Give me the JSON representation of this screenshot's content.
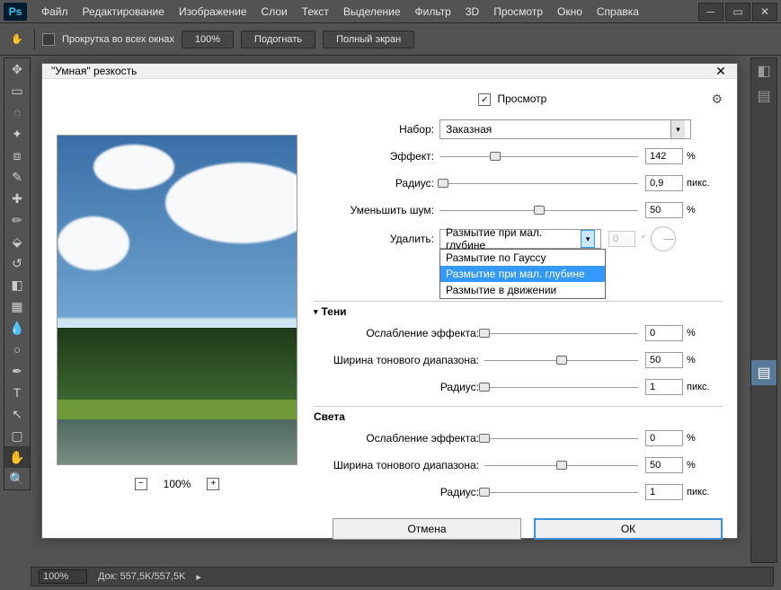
{
  "app": {
    "logo": "Ps"
  },
  "menu": {
    "file": "Файл",
    "edit": "Редактирование",
    "image": "Изображение",
    "layer": "Слои",
    "type": "Текст",
    "select": "Выделение",
    "filter": "Фильтр",
    "threeD": "3D",
    "view": "Просмотр",
    "window": "Окно",
    "help": "Справка"
  },
  "optbar": {
    "scroll_all": "Прокрутка во всех окнах",
    "zoom100": "100%",
    "fit": "Подогнать",
    "fullscreen": "Полный экран"
  },
  "dialog": {
    "title": "\"Умная\" резкость",
    "preview_chk": "Просмотр",
    "preset_label": "Набор:",
    "preset_value": "Заказная",
    "amount_label": "Эффект:",
    "amount_value": "142",
    "amount_unit": "%",
    "radius_label": "Радиус:",
    "radius_value": "0,9",
    "radius_unit": "пикс.",
    "noise_label": "Уменьшить шум:",
    "noise_value": "50",
    "noise_unit": "%",
    "remove_label": "Удалить:",
    "remove_value": "Размытие при мал. глубине",
    "remove_options": {
      "gauss": "Размытие по Гауссу",
      "lens": "Размытие при мал. глубине",
      "motion": "Размытие в движении"
    },
    "angle_value": "0",
    "shadows": {
      "title": "Тени",
      "fade_label": "Ослабление эффекта:",
      "fade_value": "0",
      "fade_unit": "%",
      "tonal_label": "Ширина тонового диапазона:",
      "tonal_value": "50",
      "tonal_unit": "%",
      "radius_label": "Радиус:",
      "radius_value": "1",
      "radius_unit": "пикс."
    },
    "highlights": {
      "title": "Света",
      "fade_label": "Ослабление эффекта:",
      "fade_value": "0",
      "fade_unit": "%",
      "tonal_label": "Ширина тонового диапазона:",
      "tonal_value": "50",
      "tonal_unit": "%",
      "radius_label": "Радиус:",
      "radius_value": "1",
      "radius_unit": "пикс."
    },
    "preview_zoom": "100%",
    "cancel": "Отмена",
    "ok": "ОК"
  },
  "status": {
    "zoom": "100%",
    "doc": "Док: 557,5K/557,5K"
  }
}
